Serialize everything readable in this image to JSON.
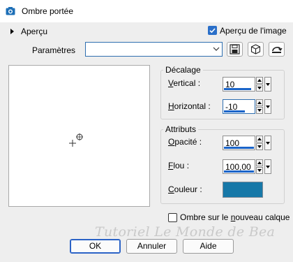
{
  "window": {
    "title": "Ombre portée"
  },
  "preview_toggle": {
    "label": "Aperçu"
  },
  "preview_checkbox": {
    "label": "Aperçu de l'image",
    "checked": true
  },
  "params": {
    "label": "Paramètres",
    "value": ""
  },
  "decalage": {
    "title": "Décalage",
    "vertical": {
      "label": "Vertical :",
      "value": "10"
    },
    "horizontal": {
      "label": "Horizontal :",
      "value": "-10"
    }
  },
  "attributs": {
    "title": "Attributs",
    "opacite": {
      "label": "Opacité :",
      "value": "100"
    },
    "flou": {
      "label": "Flou :",
      "value": "100,00"
    },
    "couleur": {
      "label": "Couleur :",
      "color": "#1778a8"
    }
  },
  "new_layer": {
    "label": "Ombre sur le nouveau calque",
    "checked": false
  },
  "watermark": "Tutoriel Le Monde de Bea",
  "buttons": {
    "ok": "OK",
    "cancel": "Annuler",
    "help": "Aide"
  },
  "colors": {
    "accent": "#2a6fc9",
    "swatch": "#1778a8"
  },
  "icons": [
    "camera-app-icon",
    "chevron-right-icon",
    "save-preset-icon",
    "cube-icon",
    "reset-icon",
    "crosshair-icon"
  ]
}
